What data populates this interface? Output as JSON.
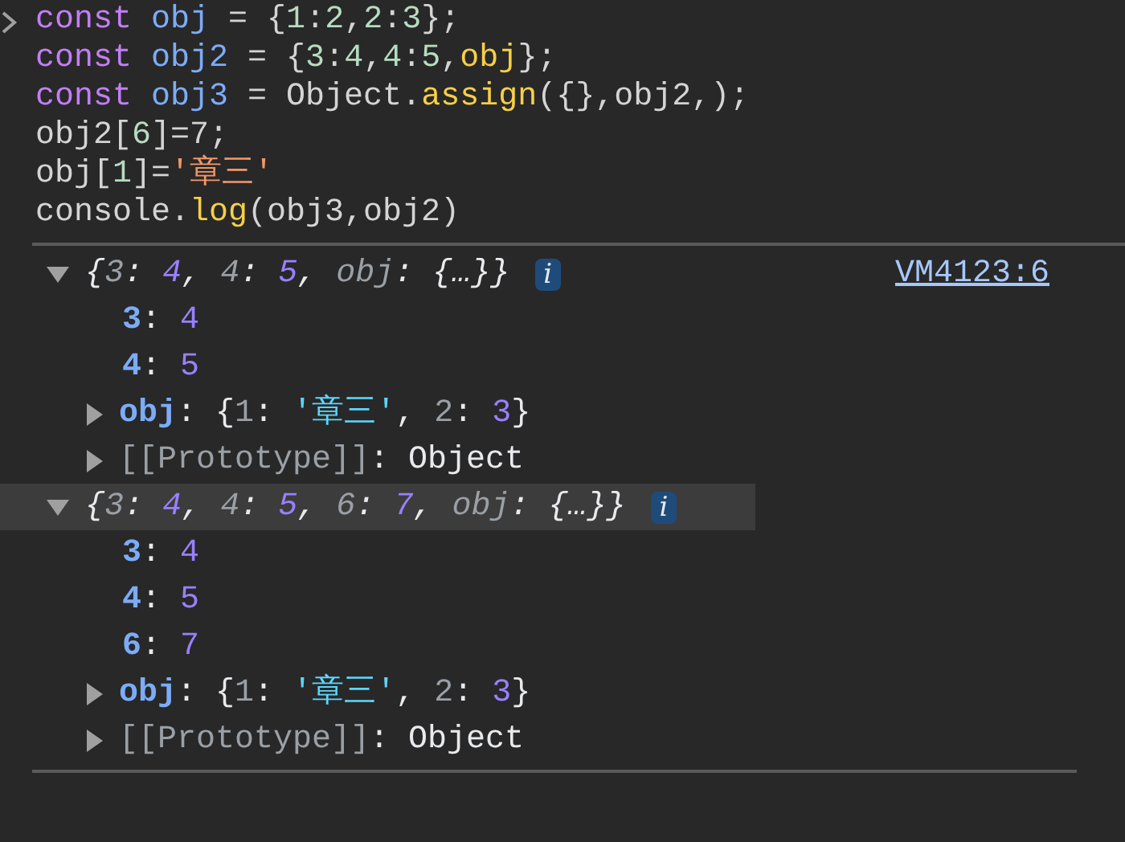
{
  "code_lines": [
    {
      "tokens": [
        {
          "text": "const ",
          "kind": "keyword"
        },
        {
          "text": "obj",
          "kind": "variable"
        },
        {
          "text": " = {",
          "kind": "plain"
        },
        {
          "text": "1",
          "kind": "number"
        },
        {
          "text": ":",
          "kind": "plain"
        },
        {
          "text": "2",
          "kind": "number"
        },
        {
          "text": ",",
          "kind": "plain"
        },
        {
          "text": "2",
          "kind": "number"
        },
        {
          "text": ":",
          "kind": "plain"
        },
        {
          "text": "3",
          "kind": "number"
        },
        {
          "text": "};",
          "kind": "plain"
        }
      ]
    },
    {
      "tokens": [
        {
          "text": "const ",
          "kind": "keyword"
        },
        {
          "text": "obj2",
          "kind": "variable"
        },
        {
          "text": " = {",
          "kind": "plain"
        },
        {
          "text": "3",
          "kind": "number"
        },
        {
          "text": ":",
          "kind": "plain"
        },
        {
          "text": "4",
          "kind": "number"
        },
        {
          "text": ",",
          "kind": "plain"
        },
        {
          "text": "4",
          "kind": "number"
        },
        {
          "text": ":",
          "kind": "plain"
        },
        {
          "text": "5",
          "kind": "number"
        },
        {
          "text": ",",
          "kind": "plain"
        },
        {
          "text": "obj",
          "kind": "function"
        },
        {
          "text": "};",
          "kind": "plain"
        }
      ]
    },
    {
      "tokens": [
        {
          "text": "const ",
          "kind": "keyword"
        },
        {
          "text": "obj3",
          "kind": "variable"
        },
        {
          "text": " = Object.",
          "kind": "plain"
        },
        {
          "text": "assign",
          "kind": "function"
        },
        {
          "text": "({},obj2,);",
          "kind": "plain"
        }
      ]
    },
    {
      "tokens": [
        {
          "text": "obj2[",
          "kind": "plain"
        },
        {
          "text": "6",
          "kind": "number"
        },
        {
          "text": "]=7;",
          "kind": "plain"
        }
      ]
    },
    {
      "tokens": [
        {
          "text": "obj[",
          "kind": "plain"
        },
        {
          "text": "1",
          "kind": "number"
        },
        {
          "text": "]=",
          "kind": "plain"
        },
        {
          "text": "'章三'",
          "kind": "string"
        }
      ]
    },
    {
      "tokens": [
        {
          "text": "console.",
          "kind": "plain"
        },
        {
          "text": "log",
          "kind": "function"
        },
        {
          "text": "(obj3,obj2)",
          "kind": "plain"
        }
      ]
    }
  ],
  "logs": [
    {
      "expanded": true,
      "selected": false,
      "info_badge": "i",
      "source": "VM4123:6",
      "summary": [
        {
          "text": "{",
          "kind": "punct"
        },
        {
          "text": "3",
          "kind": "key"
        },
        {
          "text": ": ",
          "kind": "punct"
        },
        {
          "text": "4",
          "kind": "value"
        },
        {
          "text": ", ",
          "kind": "punct"
        },
        {
          "text": "4",
          "kind": "key"
        },
        {
          "text": ": ",
          "kind": "punct"
        },
        {
          "text": "5",
          "kind": "value"
        },
        {
          "text": ", ",
          "kind": "punct"
        },
        {
          "text": "obj",
          "kind": "key"
        },
        {
          "text": ": {…}}",
          "kind": "punct"
        }
      ],
      "properties": [
        {
          "kind": "primitive",
          "tokens": [
            {
              "text": "3",
              "kind": "prop"
            },
            {
              "text": ": ",
              "kind": "punct"
            },
            {
              "text": "4",
              "kind": "value"
            }
          ]
        },
        {
          "kind": "primitive",
          "tokens": [
            {
              "text": "4",
              "kind": "prop"
            },
            {
              "text": ": ",
              "kind": "punct"
            },
            {
              "text": "5",
              "kind": "value"
            }
          ]
        },
        {
          "kind": "object",
          "expanded": false,
          "tokens": [
            {
              "text": "obj",
              "kind": "prop"
            },
            {
              "text": ": {",
              "kind": "punct"
            },
            {
              "text": "1",
              "kind": "key"
            },
            {
              "text": ": ",
              "kind": "punct"
            },
            {
              "text": "'章三'",
              "kind": "string_value"
            },
            {
              "text": ", ",
              "kind": "punct"
            },
            {
              "text": "2",
              "kind": "key"
            },
            {
              "text": ": ",
              "kind": "punct"
            },
            {
              "text": "3",
              "kind": "value"
            },
            {
              "text": "}",
              "kind": "punct"
            }
          ]
        },
        {
          "kind": "object",
          "expanded": false,
          "tokens": [
            {
              "text": "[[Prototype]]",
              "kind": "key_plain"
            },
            {
              "text": ": Object",
              "kind": "punct"
            }
          ]
        }
      ]
    },
    {
      "expanded": true,
      "selected": true,
      "info_badge": "i",
      "summary": [
        {
          "text": "{",
          "kind": "punct"
        },
        {
          "text": "3",
          "kind": "key"
        },
        {
          "text": ": ",
          "kind": "punct"
        },
        {
          "text": "4",
          "kind": "value"
        },
        {
          "text": ", ",
          "kind": "punct"
        },
        {
          "text": "4",
          "kind": "key"
        },
        {
          "text": ": ",
          "kind": "punct"
        },
        {
          "text": "5",
          "kind": "value"
        },
        {
          "text": ", ",
          "kind": "punct"
        },
        {
          "text": "6",
          "kind": "key"
        },
        {
          "text": ": ",
          "kind": "punct"
        },
        {
          "text": "7",
          "kind": "value"
        },
        {
          "text": ", ",
          "kind": "punct"
        },
        {
          "text": "obj",
          "kind": "key"
        },
        {
          "text": ": {…}}",
          "kind": "punct"
        }
      ],
      "properties": [
        {
          "kind": "primitive",
          "tokens": [
            {
              "text": "3",
              "kind": "prop"
            },
            {
              "text": ": ",
              "kind": "punct"
            },
            {
              "text": "4",
              "kind": "value"
            }
          ]
        },
        {
          "kind": "primitive",
          "tokens": [
            {
              "text": "4",
              "kind": "prop"
            },
            {
              "text": ": ",
              "kind": "punct"
            },
            {
              "text": "5",
              "kind": "value"
            }
          ]
        },
        {
          "kind": "primitive",
          "tokens": [
            {
              "text": "6",
              "kind": "prop"
            },
            {
              "text": ": ",
              "kind": "punct"
            },
            {
              "text": "7",
              "kind": "value"
            }
          ]
        },
        {
          "kind": "object",
          "expanded": false,
          "tokens": [
            {
              "text": "obj",
              "kind": "prop"
            },
            {
              "text": ": {",
              "kind": "punct"
            },
            {
              "text": "1",
              "kind": "key"
            },
            {
              "text": ": ",
              "kind": "punct"
            },
            {
              "text": "'章三'",
              "kind": "string_value"
            },
            {
              "text": ", ",
              "kind": "punct"
            },
            {
              "text": "2",
              "kind": "key"
            },
            {
              "text": ": ",
              "kind": "punct"
            },
            {
              "text": "3",
              "kind": "value"
            },
            {
              "text": "}",
              "kind": "punct"
            }
          ]
        },
        {
          "kind": "object",
          "expanded": false,
          "tokens": [
            {
              "text": "[[Prototype]]",
              "kind": "key_plain"
            },
            {
              "text": ": Object",
              "kind": "punct"
            }
          ]
        }
      ]
    }
  ]
}
